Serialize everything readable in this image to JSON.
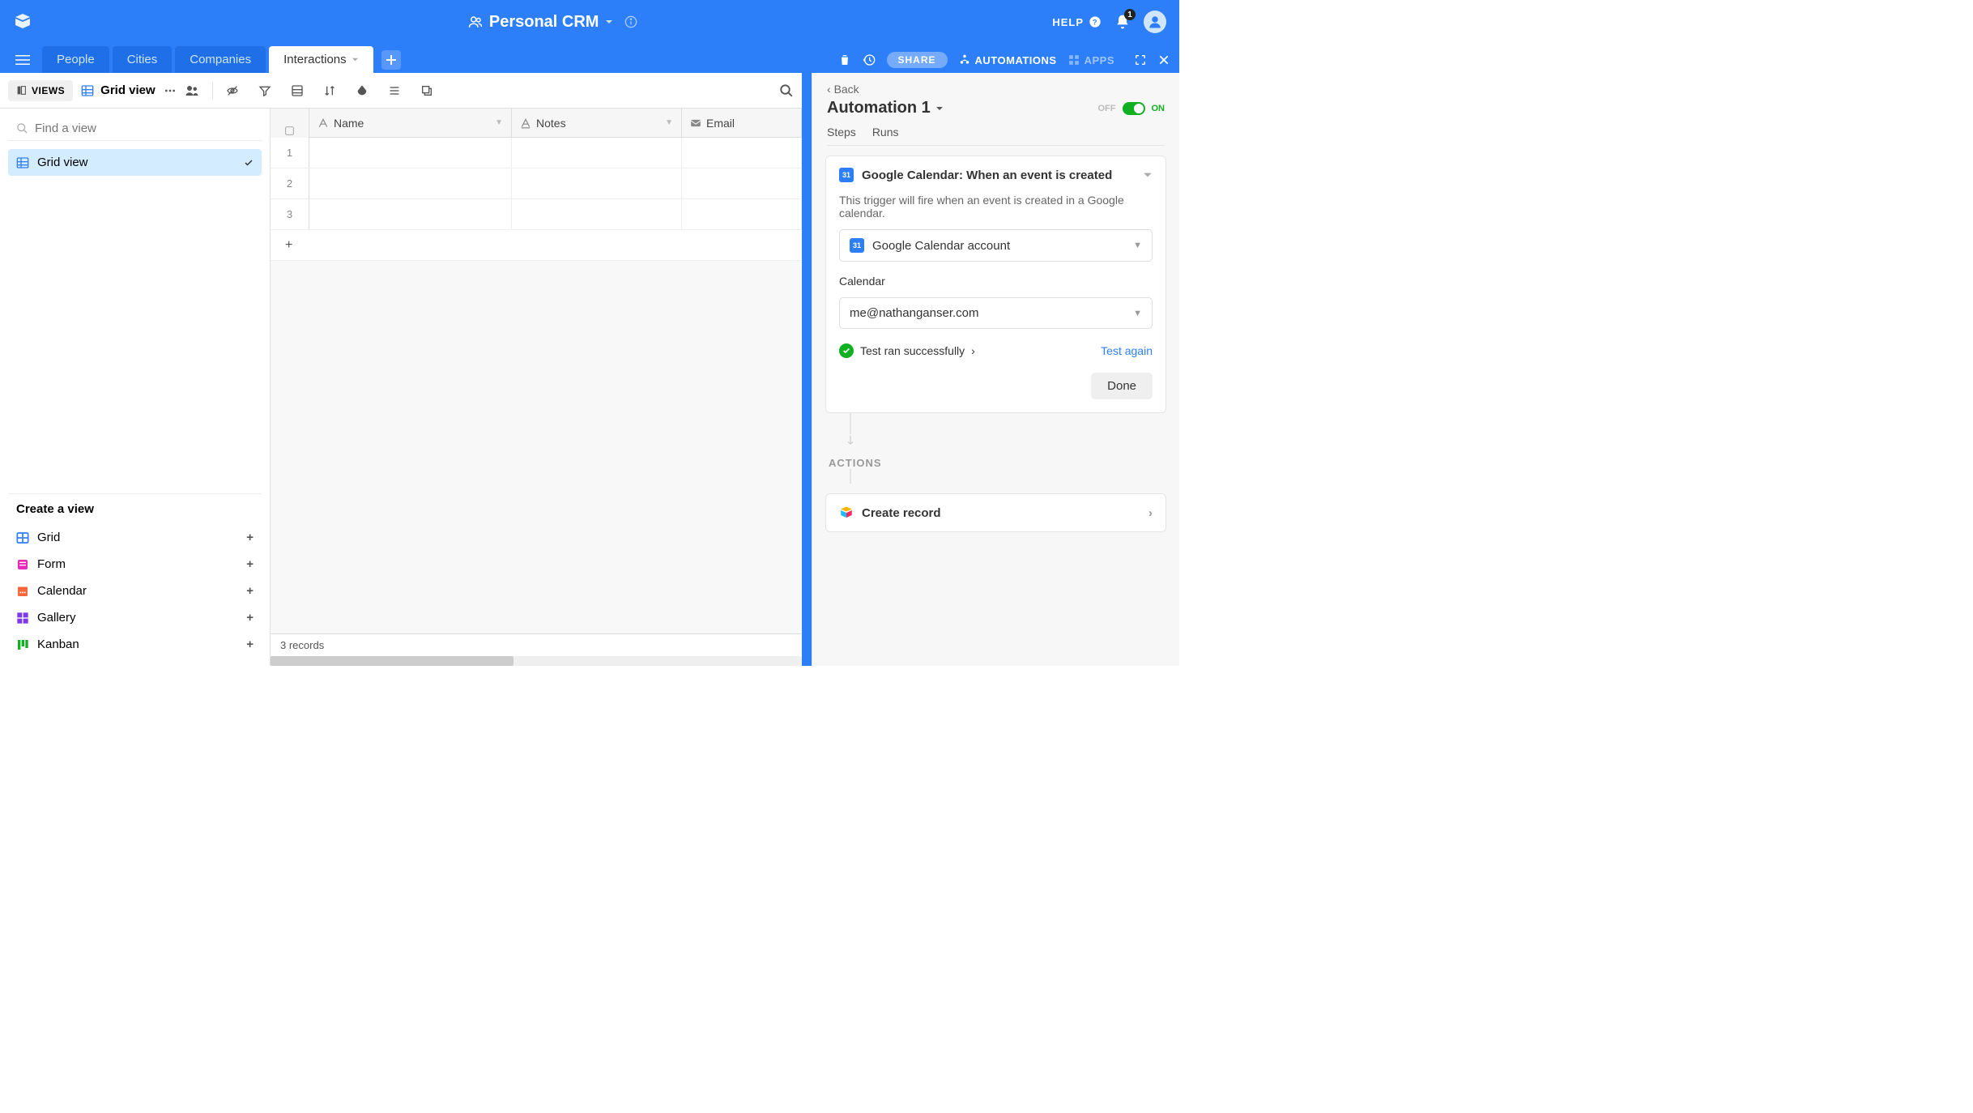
{
  "header": {
    "base_title": "Personal CRM",
    "help_label": "HELP",
    "notification_count": "1"
  },
  "tabs": {
    "items": [
      "People",
      "Cities",
      "Companies",
      "Interactions"
    ],
    "active_index": 3,
    "share_label": "SHARE",
    "automations_label": "AUTOMATIONS",
    "apps_label": "APPS"
  },
  "toolbar": {
    "views_btn": "VIEWS",
    "current_view": "Grid view"
  },
  "sidebar": {
    "search_placeholder": "Find a view",
    "active_view": "Grid view",
    "create_header": "Create a view",
    "create_options": [
      {
        "label": "Grid",
        "color": "#2d7ff9"
      },
      {
        "label": "Form",
        "color": "#e929ba"
      },
      {
        "label": "Calendar",
        "color": "#f7653b"
      },
      {
        "label": "Gallery",
        "color": "#7c39ed"
      },
      {
        "label": "Kanban",
        "color": "#11af22"
      }
    ]
  },
  "grid": {
    "columns": [
      "Name",
      "Notes",
      "Email"
    ],
    "row_numbers": [
      "1",
      "2",
      "3"
    ],
    "footer": "3 records"
  },
  "automation": {
    "back_label": "Back",
    "title": "Automation 1",
    "toggle_off": "OFF",
    "toggle_on": "ON",
    "tabs": [
      "Steps",
      "Runs"
    ],
    "trigger": {
      "title": "Google Calendar: When an event is created",
      "desc": "This trigger will fire when an event is created in a Google calendar.",
      "account_label": "Google Calendar account",
      "calendar_label": "Calendar",
      "calendar_value": "me@nathanganser.com",
      "test_success": "Test ran successfully",
      "test_again": "Test again",
      "done": "Done"
    },
    "actions_label": "ACTIONS",
    "action_step": "Create record"
  }
}
